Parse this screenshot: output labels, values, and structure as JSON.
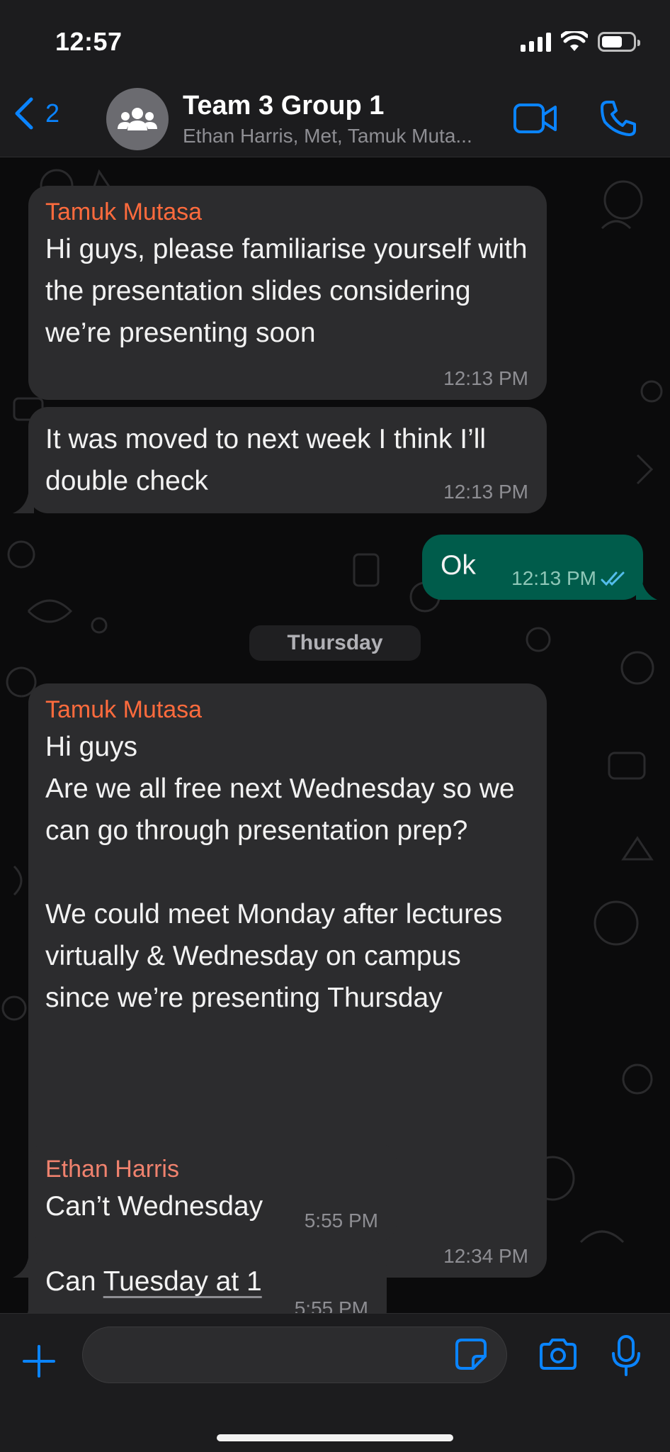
{
  "status_bar": {
    "time": "12:57"
  },
  "header": {
    "back_count": "2",
    "title": "Team 3 Group 1",
    "members": "Ethan Harris, Met, Tamuk Muta..."
  },
  "messages": [
    {
      "sender": "Tamuk Mutasa",
      "sender_color": "#ff6b3d",
      "text": "Hi guys, please familiarise yourself with the presentation slides considering we’re presenting soon",
      "time": "12:13 PM",
      "direction": "incoming"
    },
    {
      "sender": "",
      "text": "It was moved to next week I think I’ll double check",
      "time": "12:13 PM",
      "direction": "incoming"
    },
    {
      "sender": "",
      "text": "Ok",
      "time": "12:13 PM",
      "direction": "outgoing",
      "read_status": "read"
    },
    {
      "sender": "Tamuk Mutasa",
      "sender_color": "#ff6b3d",
      "text": "Hi guys\nAre we all free next Wednesday so we can go through presentation prep?\n\nWe could meet Monday after lectures virtually & Wednesday on campus since we’re presenting Thursday",
      "time": "12:34 PM",
      "direction": "incoming"
    },
    {
      "sender": "Ethan Harris",
      "sender_color": "#f0826e",
      "text": "Can’t Wednesday",
      "time": "5:55 PM",
      "direction": "incoming"
    },
    {
      "sender": "",
      "text_prefix": "Can ",
      "text_link": "Tuesday at 1",
      "time": "5:55 PM",
      "direction": "incoming"
    }
  ],
  "date_separator": "Thursday",
  "input": {
    "placeholder": ""
  },
  "icons": {
    "back": "chevron-left-icon",
    "group_avatar": "group-people-icon",
    "video": "video-camera-icon",
    "call": "phone-icon",
    "plus": "plus-icon",
    "sticker": "sticker-icon",
    "camera": "camera-icon",
    "mic": "microphone-icon",
    "read_receipt": "double-check-icon"
  },
  "colors": {
    "accent": "#0a84ff",
    "outgoing_bubble": "#005c4b",
    "incoming_bubble": "#2c2c2e"
  }
}
